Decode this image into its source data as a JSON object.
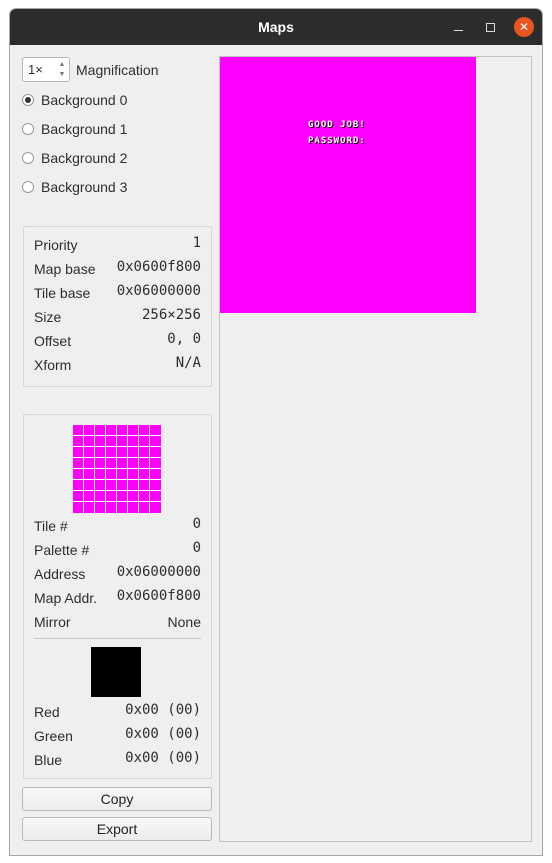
{
  "window": {
    "title": "Maps"
  },
  "controls": {
    "magnification_value": "1×",
    "magnification_label": "Magnification",
    "backgrounds": [
      "Background 0",
      "Background 1",
      "Background 2",
      "Background 3"
    ],
    "selected_background": 0
  },
  "map_info": {
    "priority": {
      "label": "Priority",
      "value": "1"
    },
    "map_base": {
      "label": "Map base",
      "value": "0x0600f800"
    },
    "tile_base": {
      "label": "Tile base",
      "value": "0x06000000"
    },
    "size": {
      "label": "Size",
      "value": "256×256"
    },
    "offset": {
      "label": "Offset",
      "value": "0, 0"
    },
    "xform": {
      "label": "Xform",
      "value": "N/A"
    }
  },
  "tile_info": {
    "tile_color": "#ff00ff",
    "tile_num": {
      "label": "Tile #",
      "value": "0"
    },
    "palette_num": {
      "label": "Palette #",
      "value": "0"
    },
    "address": {
      "label": "Address",
      "value": "0x06000000"
    },
    "map_addr": {
      "label": "Map Addr.",
      "value": "0x0600f800"
    },
    "mirror": {
      "label": "Mirror",
      "value": "None"
    }
  },
  "color_info": {
    "swatch_color": "#000000",
    "red": {
      "label": "Red",
      "value": "0x00 (00)"
    },
    "green": {
      "label": "Green",
      "value": "0x00 (00)"
    },
    "blue": {
      "label": "Blue",
      "value": "0x00 (00)"
    }
  },
  "buttons": {
    "copy": "Copy",
    "export": "Export"
  },
  "preview": {
    "background_color": "#ff00ff",
    "text_lines": [
      "GOOD JOB!",
      "PASSWORD:"
    ]
  }
}
